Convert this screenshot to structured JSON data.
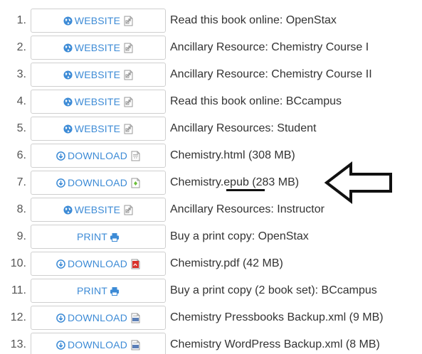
{
  "rows": [
    {
      "num": "1.",
      "button_label": "WEBSITE",
      "button_type": "website",
      "file_icon": "external-link-icon",
      "description": "Read this book online: OpenStax"
    },
    {
      "num": "2.",
      "button_label": "WEBSITE",
      "button_type": "website",
      "file_icon": "external-link-icon",
      "description": "Ancillary Resource: Chemistry Course I"
    },
    {
      "num": "3.",
      "button_label": "WEBSITE",
      "button_type": "website",
      "file_icon": "external-link-icon",
      "description": "Ancillary Resource: Chemistry Course II"
    },
    {
      "num": "4.",
      "button_label": "WEBSITE",
      "button_type": "website",
      "file_icon": "external-link-icon",
      "description": "Read this book online: BCcampus"
    },
    {
      "num": "5.",
      "button_label": "WEBSITE",
      "button_type": "website",
      "file_icon": "external-link-icon",
      "description": "Ancillary Resources: Student"
    },
    {
      "num": "6.",
      "button_label": "DOWNLOAD",
      "button_type": "download",
      "file_icon": "html-file-icon",
      "description": "Chemistry.html (308 MB)"
    },
    {
      "num": "7.",
      "button_label": "DOWNLOAD",
      "button_type": "download",
      "file_icon": "epub-file-icon",
      "description": "Chemistry.epub (283 MB)"
    },
    {
      "num": "8.",
      "button_label": "WEBSITE",
      "button_type": "website",
      "file_icon": "external-link-icon",
      "description": "Ancillary Resources: Instructor"
    },
    {
      "num": "9.",
      "button_label": "PRINT",
      "button_type": "print",
      "file_icon": "printer-icon",
      "description": "Buy a print copy: OpenStax"
    },
    {
      "num": "10.",
      "button_label": "DOWNLOAD",
      "button_type": "download",
      "file_icon": "pdf-file-icon",
      "description": "Chemistry.pdf (42 MB)"
    },
    {
      "num": "11.",
      "button_label": "PRINT",
      "button_type": "print",
      "file_icon": "printer-icon",
      "description": "Buy a print copy (2 book set): BCcampus"
    },
    {
      "num": "12.",
      "button_label": "DOWNLOAD",
      "button_type": "download",
      "file_icon": "xml-file-icon",
      "description": "Chemistry Pressbooks Backup.xml (9 MB)"
    },
    {
      "num": "13.",
      "button_label": "DOWNLOAD",
      "button_type": "download",
      "file_icon": "xml-file-icon",
      "description": "Chemistry WordPress Backup.xml (8 MB)"
    }
  ],
  "colors": {
    "button_text": "#3d8bd6",
    "button_border": "#cfcfcf",
    "number_text": "#555555",
    "description_text": "#333333",
    "annotation": "#111111",
    "pdf_red": "#d9322b",
    "epub_green": "#6cbf3a"
  },
  "annotations": {
    "arrow_icon": "left-arrow-annotation-icon",
    "underline": "epub-underline-annotation"
  }
}
